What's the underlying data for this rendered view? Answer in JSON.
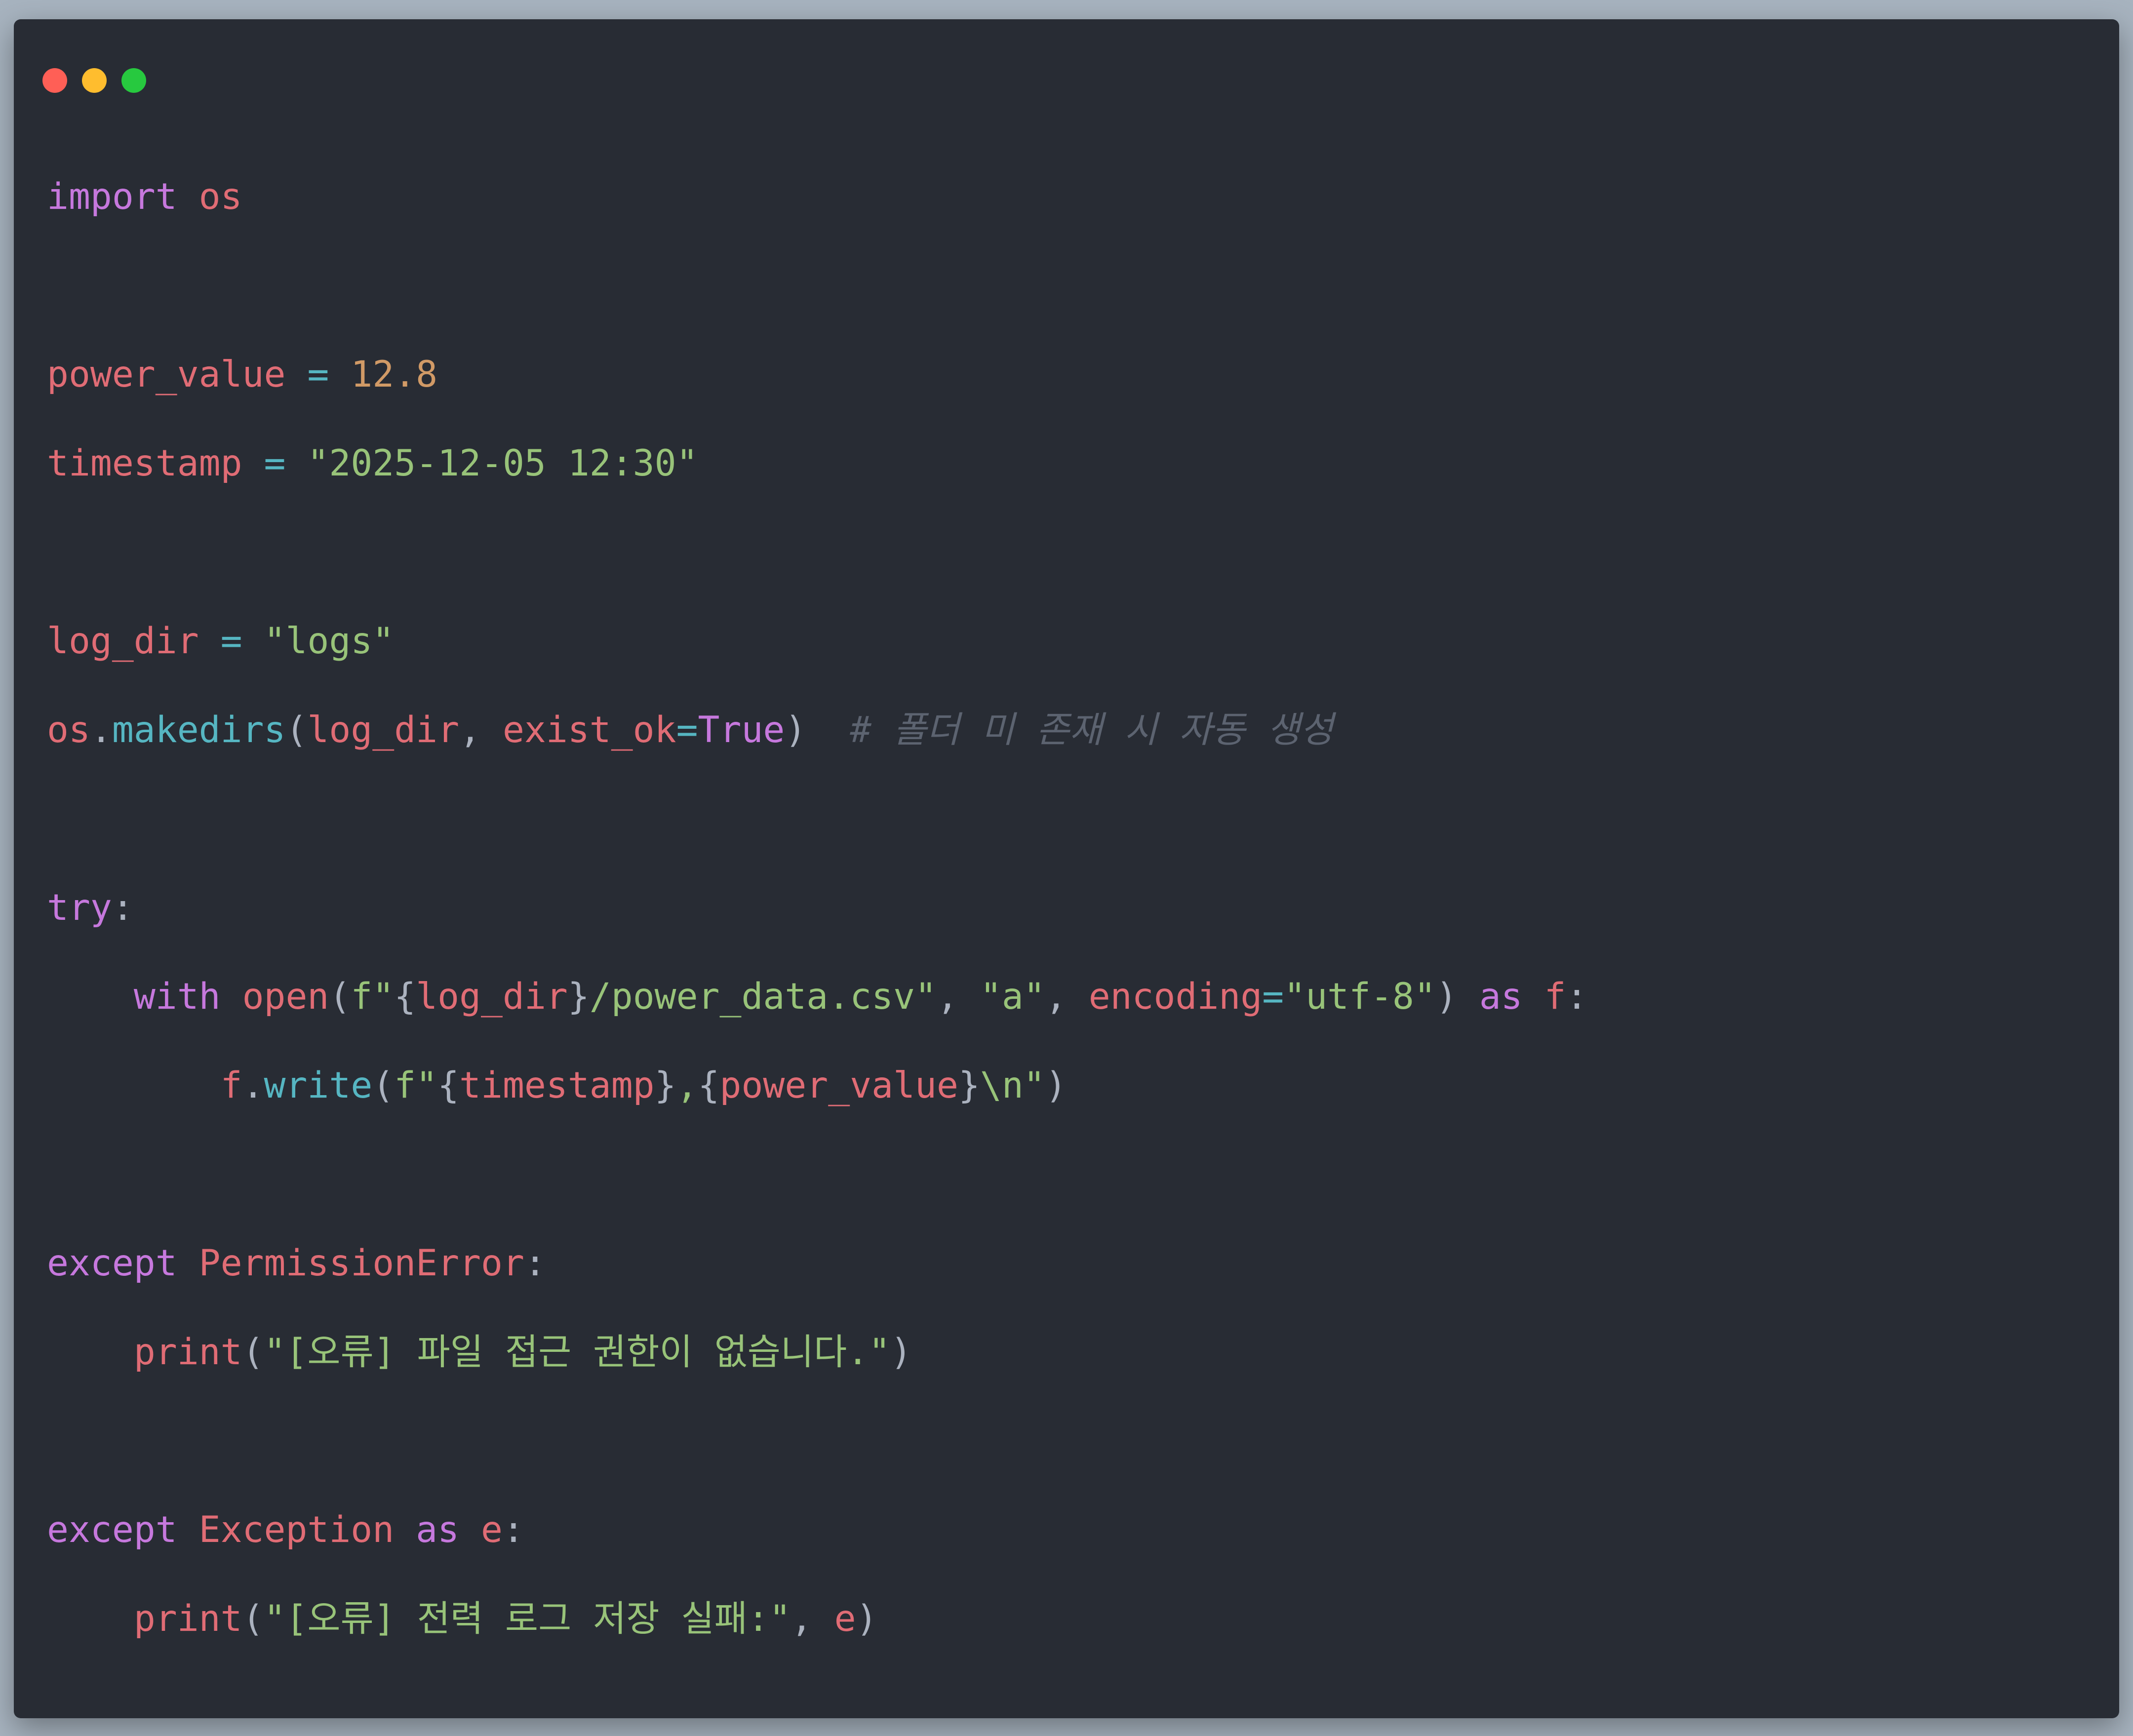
{
  "window": {
    "controls": [
      {
        "name": "close-button",
        "color": "#ff5f56"
      },
      {
        "name": "minimize-button",
        "color": "#ffbd2e"
      },
      {
        "name": "maximize-button",
        "color": "#27c93f"
      }
    ]
  },
  "theme": {
    "background": "#282c34",
    "keyword": "#c678dd",
    "variable": "#e06c75",
    "number": "#d19a66",
    "string": "#98c379",
    "function": "#56b6c2",
    "punctuation": "#abb2bf",
    "comment": "#5c6370"
  },
  "code": {
    "language": "python",
    "lines": [
      [
        {
          "t": "import",
          "c": "keyword"
        },
        {
          "t": " ",
          "c": "punctuation"
        },
        {
          "t": "os",
          "c": "variable"
        }
      ],
      [],
      [
        {
          "t": "power_value",
          "c": "variable"
        },
        {
          "t": " = ",
          "c": "function"
        },
        {
          "t": "12.8",
          "c": "number"
        }
      ],
      [
        {
          "t": "timestamp",
          "c": "variable"
        },
        {
          "t": " = ",
          "c": "function"
        },
        {
          "t": "\"2025-12-05 12:30\"",
          "c": "string"
        }
      ],
      [],
      [
        {
          "t": "log_dir",
          "c": "variable"
        },
        {
          "t": " = ",
          "c": "function"
        },
        {
          "t": "\"logs\"",
          "c": "string"
        }
      ],
      [
        {
          "t": "os",
          "c": "variable"
        },
        {
          "t": ".",
          "c": "punctuation"
        },
        {
          "t": "makedirs",
          "c": "function"
        },
        {
          "t": "(",
          "c": "punctuation"
        },
        {
          "t": "log_dir",
          "c": "variable"
        },
        {
          "t": ", ",
          "c": "punctuation"
        },
        {
          "t": "exist_ok",
          "c": "variable"
        },
        {
          "t": "=",
          "c": "function"
        },
        {
          "t": "True",
          "c": "keyword"
        },
        {
          "t": ")  ",
          "c": "punctuation"
        },
        {
          "t": "# 폴더 미 존재 시 자동 생성",
          "c": "comment"
        }
      ],
      [],
      [
        {
          "t": "try",
          "c": "keyword"
        },
        {
          "t": ":",
          "c": "punctuation"
        }
      ],
      [
        {
          "t": "    ",
          "c": "punctuation"
        },
        {
          "t": "with",
          "c": "keyword"
        },
        {
          "t": " ",
          "c": "punctuation"
        },
        {
          "t": "open",
          "c": "variable"
        },
        {
          "t": "(",
          "c": "punctuation"
        },
        {
          "t": "f\"",
          "c": "string"
        },
        {
          "t": "{",
          "c": "punctuation"
        },
        {
          "t": "log_dir",
          "c": "variable"
        },
        {
          "t": "}",
          "c": "punctuation"
        },
        {
          "t": "/power_data.csv\"",
          "c": "string"
        },
        {
          "t": ", ",
          "c": "punctuation"
        },
        {
          "t": "\"a\"",
          "c": "string"
        },
        {
          "t": ", ",
          "c": "punctuation"
        },
        {
          "t": "encoding",
          "c": "variable"
        },
        {
          "t": "=",
          "c": "function"
        },
        {
          "t": "\"utf-8\"",
          "c": "string"
        },
        {
          "t": ") ",
          "c": "punctuation"
        },
        {
          "t": "as",
          "c": "keyword"
        },
        {
          "t": " ",
          "c": "punctuation"
        },
        {
          "t": "f",
          "c": "variable"
        },
        {
          "t": ":",
          "c": "punctuation"
        }
      ],
      [
        {
          "t": "        ",
          "c": "punctuation"
        },
        {
          "t": "f",
          "c": "variable"
        },
        {
          "t": ".",
          "c": "punctuation"
        },
        {
          "t": "write",
          "c": "function"
        },
        {
          "t": "(",
          "c": "punctuation"
        },
        {
          "t": "f\"",
          "c": "string"
        },
        {
          "t": "{",
          "c": "punctuation"
        },
        {
          "t": "timestamp",
          "c": "variable"
        },
        {
          "t": "}",
          "c": "punctuation"
        },
        {
          "t": ",",
          "c": "string"
        },
        {
          "t": "{",
          "c": "punctuation"
        },
        {
          "t": "power_value",
          "c": "variable"
        },
        {
          "t": "}",
          "c": "punctuation"
        },
        {
          "t": "\\n\"",
          "c": "string"
        },
        {
          "t": ")",
          "c": "punctuation"
        }
      ],
      [],
      [
        {
          "t": "except",
          "c": "keyword"
        },
        {
          "t": " ",
          "c": "punctuation"
        },
        {
          "t": "PermissionError",
          "c": "variable"
        },
        {
          "t": ":",
          "c": "punctuation"
        }
      ],
      [
        {
          "t": "    ",
          "c": "punctuation"
        },
        {
          "t": "print",
          "c": "variable"
        },
        {
          "t": "(",
          "c": "punctuation"
        },
        {
          "t": "\"[오류] 파일 접근 권한이 없습니다.\"",
          "c": "string"
        },
        {
          "t": ")",
          "c": "punctuation"
        }
      ],
      [],
      [
        {
          "t": "except",
          "c": "keyword"
        },
        {
          "t": " ",
          "c": "punctuation"
        },
        {
          "t": "Exception",
          "c": "variable"
        },
        {
          "t": " ",
          "c": "punctuation"
        },
        {
          "t": "as",
          "c": "keyword"
        },
        {
          "t": " ",
          "c": "punctuation"
        },
        {
          "t": "e",
          "c": "variable"
        },
        {
          "t": ":",
          "c": "punctuation"
        }
      ],
      [
        {
          "t": "    ",
          "c": "punctuation"
        },
        {
          "t": "print",
          "c": "variable"
        },
        {
          "t": "(",
          "c": "punctuation"
        },
        {
          "t": "\"[오류] 전력 로그 저장 실패:\"",
          "c": "string"
        },
        {
          "t": ", ",
          "c": "punctuation"
        },
        {
          "t": "e",
          "c": "variable"
        },
        {
          "t": ")",
          "c": "punctuation"
        }
      ]
    ]
  }
}
